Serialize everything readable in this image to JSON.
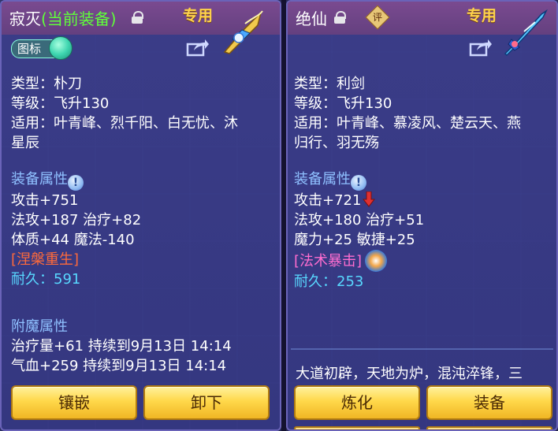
{
  "left": {
    "name_main": "寂灭",
    "name_suffix": "(当前装备)",
    "exclusive": "专用",
    "icon_toggle_label": "图标",
    "type": "类型：朴刀",
    "level": "等级：飞升130",
    "applicable_line1": "适用：叶青峰、烈千阳、白无忧、沐",
    "applicable_line2": "星辰",
    "section_equip_attr": "装备属性",
    "attr1": "攻击+751",
    "attr2": "法攻+187 治疗+82",
    "attr3": "体质+44 魔法-140",
    "special": "[涅槃重生]",
    "durability": "耐久：591",
    "section_enchant": "附魔属性",
    "enchant1": "治疗量+61 持续到9月13日 14:14",
    "enchant2": "气血+259 持续到9月13日 14:14",
    "btn_inlay": "镶嵌",
    "btn_unequip": "卸下"
  },
  "right": {
    "name_main": "绝仙",
    "rating": "评",
    "exclusive": "专用",
    "type": "类型：利剑",
    "level": "等级：飞升130",
    "applicable_line1": "适用：叶青峰、慕凌风、楚云天、燕",
    "applicable_line2": "归行、羽无殇",
    "section_equip_attr": "装备属性",
    "attr1": "攻击+721",
    "attr2": "法攻+180 治疗+51",
    "attr3": "魔力+25 敏捷+25",
    "special": "[法术暴击]",
    "durability": "耐久：253",
    "description": "大道初辟，天地为炉，混沌淬锋，三",
    "btn_refine": "炼化",
    "btn_equip": "装备"
  },
  "icons": {
    "lock": "lock-icon",
    "share": "share-icon",
    "weapon": "weapon-icon",
    "info": "info-icon",
    "arrow": "arrow-down-icon",
    "skill": "skill-icon"
  },
  "colors": {
    "equipped_tag": "#5fff3a",
    "exclusive": "#ffd34a",
    "section": "#8fc0ff",
    "durability": "#58d8ff",
    "special_left": "#ff6a3a",
    "special_right": "#ff6dd0",
    "button": "#ffd84a"
  }
}
